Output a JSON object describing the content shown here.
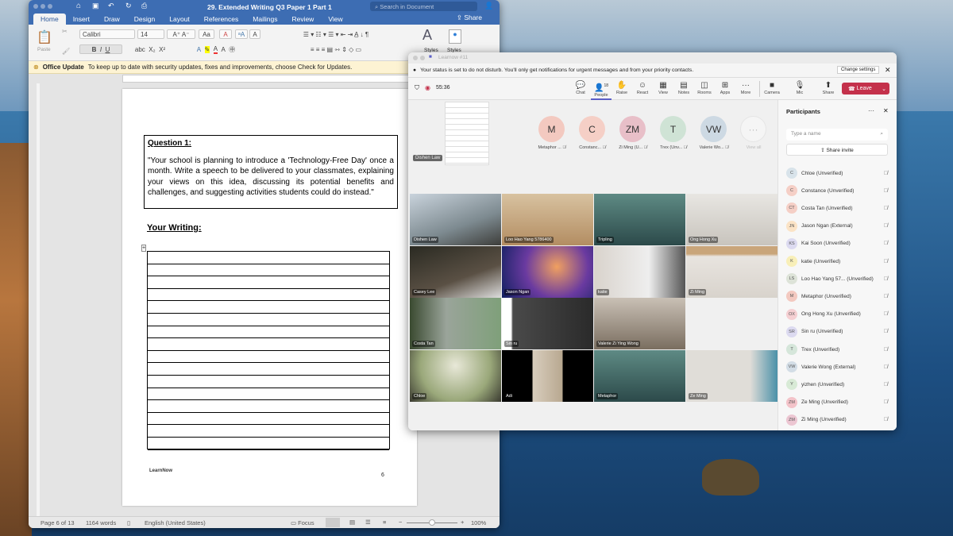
{
  "word": {
    "title": "29. Extended Writing Q3 Paper 1 Part 1",
    "search_placeholder": "Search in Document",
    "tabs": [
      "Home",
      "Insert",
      "Draw",
      "Design",
      "Layout",
      "References",
      "Mailings",
      "Review",
      "View"
    ],
    "share": "Share",
    "ribbon": {
      "paste": "Paste",
      "font": "Calibri",
      "size": "14",
      "styles": "Styles",
      "styles_pane": "Styles"
    },
    "update": {
      "title": "Office Update",
      "message": "To keep up to date with security updates, fixes and improvements, choose Check for Updates."
    },
    "doc": {
      "question_heading": "Question 1:",
      "question_text": "\"Your school is planning to introduce a 'Technology-Free Day' once a month. Write a speech to be delivered to your classmates, explaining your views on this idea, discussing its potential benefits and challenges, and suggesting activities students could do instead.\"",
      "writing_heading": "Your Writing:",
      "footer_logo": "LearnNow",
      "page_number": "6"
    },
    "status": {
      "page": "Page 6 of 13",
      "words": "1164 words",
      "language": "English (United States)",
      "focus": "Focus",
      "zoom": "100%",
      "zoom_value": 100
    }
  },
  "teams": {
    "window_title": "Learnow #11",
    "notification": "Your status is set to do not disturb. You'll only get notifications for urgent messages and from your priority contacts.",
    "change_settings": "Change settings",
    "timer": "55:36",
    "toolbar": {
      "chat": "Chat",
      "people": "People",
      "people_count": "18",
      "raise": "Raise",
      "react": "React",
      "view": "View",
      "notes": "Notes",
      "rooms": "Rooms",
      "apps": "Apps",
      "more": "More",
      "camera": "Camera",
      "mic": "Mic",
      "share": "Share",
      "leave": "Leave"
    },
    "presenter": "Dishen Law",
    "avatars": [
      {
        "initials": "M",
        "name": "Metaphor ...",
        "color": "#f3c9c0"
      },
      {
        "initials": "C",
        "name": "Constanc...",
        "color": "#f5cfc6"
      },
      {
        "initials": "ZM",
        "name": "Zi Ming (U...",
        "color": "#e8bfc8"
      },
      {
        "initials": "T",
        "name": "Trex (Unv...",
        "color": "#cfe3d5"
      },
      {
        "initials": "VW",
        "name": "Valerie Wo...",
        "color": "#cdd9e3"
      }
    ],
    "view_all": "View all",
    "tiles": [
      {
        "name": "Dishen Law",
        "bg": "linear-gradient(160deg,#c9d3dc,#7d8a90 60%,#3d3d3a)"
      },
      {
        "name": "Loo Hao Yang 5786400",
        "bg": "linear-gradient(180deg,#d8c2a0,#b38d62)"
      },
      {
        "name": "Tripling",
        "bg": "linear-gradient(180deg,#5e8a84,#2c4a4a)"
      },
      {
        "name": "Ong Hong Xu",
        "bg": "linear-gradient(180deg,#e8e6e2,#c8c4bd)"
      },
      {
        "name": "Casey Lee",
        "bg": "linear-gradient(160deg,#2a2a22,#5a5044 60%,#ddd)"
      },
      {
        "name": "Jason Ngan",
        "bg": "radial-gradient(circle at 60% 40%,#f0a060,#6a3aa0 50%,#102060)"
      },
      {
        "name": "katie",
        "bg": "linear-gradient(90deg,#d9d3cc,#eee 60%,#555)"
      },
      {
        "name": "Zi Ming",
        "bg": "linear-gradient(180deg,#c9a57a 15%,#e8e4df 20%,#d8d3cc)"
      },
      {
        "name": "Costa Tan",
        "bg": "linear-gradient(90deg,#3a4a30,#9aa49a 40%,#7fa07a)"
      },
      {
        "name": "Sin ru",
        "bg": "linear-gradient(90deg,#fff 10%,#4a4a4a 12%,#2a2a2a)"
      },
      {
        "name": "Valerie Zi Ying Wong",
        "bg": "linear-gradient(180deg,#c9c0b5,#7a6e60)"
      },
      {
        "name": "Chloe",
        "bg": "radial-gradient(circle at 50% 30%,#e8e8d8,#9aa87a 60%,#3a3a30)"
      },
      {
        "name": "Adi",
        "bg": "linear-gradient(90deg,#000 33%,#d8cdbd 34%,#b8a890 66%,#000 67%)"
      },
      {
        "name": "Metaphor",
        "bg": "linear-gradient(180deg,#5e8a84,#2c4a4a)"
      },
      {
        "name": "Ze Ming",
        "bg": "linear-gradient(90deg,#e0ddd8 70%,#4a90a8)"
      }
    ],
    "participants": {
      "title": "Participants",
      "search_placeholder": "Type a name",
      "share_invite": "Share invite",
      "list": [
        {
          "initials": "C",
          "name": "Chloe (Unverified)",
          "color": "#d8e3ea"
        },
        {
          "initials": "C",
          "name": "Constance (Unverified)",
          "color": "#f5cfc6"
        },
        {
          "initials": "CT",
          "name": "Costa Tan (Unverified)",
          "color": "#f5cfc6"
        },
        {
          "initials": "JN",
          "name": "Jason Ngan (External)",
          "color": "#fbe3c6"
        },
        {
          "initials": "KS",
          "name": "Kai Soon (Unverified)",
          "color": "#dcdaf0"
        },
        {
          "initials": "K",
          "name": "katie (Unverified)",
          "color": "#f8efb8"
        },
        {
          "initials": "LS",
          "name": "Loo Hao Yang 57... (Unverified)",
          "color": "#dde3d8"
        },
        {
          "initials": "M",
          "name": "Metaphor (Unverified)",
          "color": "#f3c9c0"
        },
        {
          "initials": "OX",
          "name": "Ong Hong Xu (Unverified)",
          "color": "#f5cfd2"
        },
        {
          "initials": "SR",
          "name": "Sin ru (Unverified)",
          "color": "#dcdaf0"
        },
        {
          "initials": "T",
          "name": "Trex (Unverified)",
          "color": "#d5e6da"
        },
        {
          "initials": "VW",
          "name": "Valerie Wong (External)",
          "color": "#d3dde6"
        },
        {
          "initials": "Y",
          "name": "yizhen (Unverified)",
          "color": "#d8ead6"
        },
        {
          "initials": "ZM",
          "name": "Ze Ming (Unverified)",
          "color": "#f3c3c9"
        },
        {
          "initials": "ZM",
          "name": "Zi Ming (Unverified)",
          "color": "#ecc6d2"
        }
      ]
    },
    "leave_color": "#c4314b",
    "accent": "#5b5fc7"
  }
}
